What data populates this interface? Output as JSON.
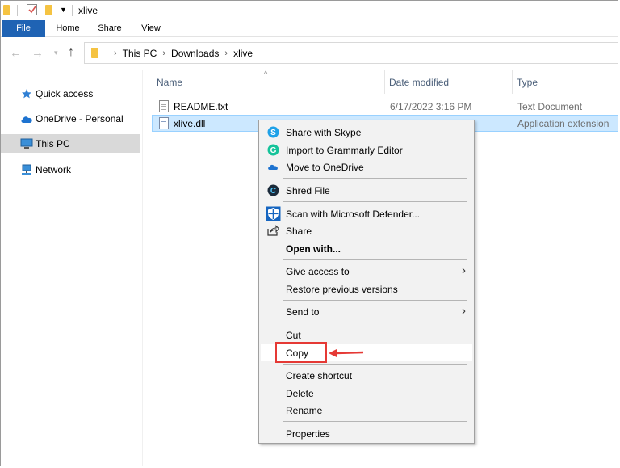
{
  "window": {
    "title": "xlive"
  },
  "ribbon": {
    "tabs": [
      {
        "label": "File"
      },
      {
        "label": "Home"
      },
      {
        "label": "Share"
      },
      {
        "label": "View"
      }
    ]
  },
  "address": {
    "breadcrumb": [
      "This PC",
      "Downloads",
      "xlive"
    ]
  },
  "sidebar": {
    "items": [
      {
        "label": "Quick access",
        "icon": "star-icon"
      },
      {
        "label": "OneDrive - Personal",
        "icon": "cloud-icon"
      },
      {
        "label": "This PC",
        "icon": "computer-icon",
        "selected": true
      },
      {
        "label": "Network",
        "icon": "network-icon"
      }
    ]
  },
  "columns": {
    "name": "Name",
    "date": "Date modified",
    "type": "Type"
  },
  "files": [
    {
      "name": "README.txt",
      "date": "6/17/2022 3:16 PM",
      "type": "Text Document"
    },
    {
      "name": "xlive.dll",
      "date": "",
      "type": "Application extension",
      "selected": true
    }
  ],
  "context_menu": {
    "items": [
      {
        "label": "Share with Skype",
        "icon": "skype-icon"
      },
      {
        "label": "Import to Grammarly Editor",
        "icon": "grammarly-icon"
      },
      {
        "label": "Move to OneDrive",
        "icon": "onedrive-icon"
      },
      {
        "label": "Shred File",
        "icon": "shred-icon"
      },
      {
        "label": "Scan with Microsoft Defender...",
        "icon": "defender-icon"
      },
      {
        "label": "Share",
        "icon": "share-icon"
      },
      {
        "label": "Open with...",
        "bold": true
      },
      {
        "label": "Give access to",
        "submenu": true
      },
      {
        "label": "Restore previous versions"
      },
      {
        "label": "Send to",
        "submenu": true
      },
      {
        "label": "Cut"
      },
      {
        "label": "Copy",
        "highlighted": true
      },
      {
        "label": "Create shortcut"
      },
      {
        "label": "Delete"
      },
      {
        "label": "Rename"
      },
      {
        "label": "Properties"
      }
    ]
  },
  "colors": {
    "accent": "#1f63b4",
    "selection": "#cce8ff",
    "annotation": "#e53935"
  }
}
